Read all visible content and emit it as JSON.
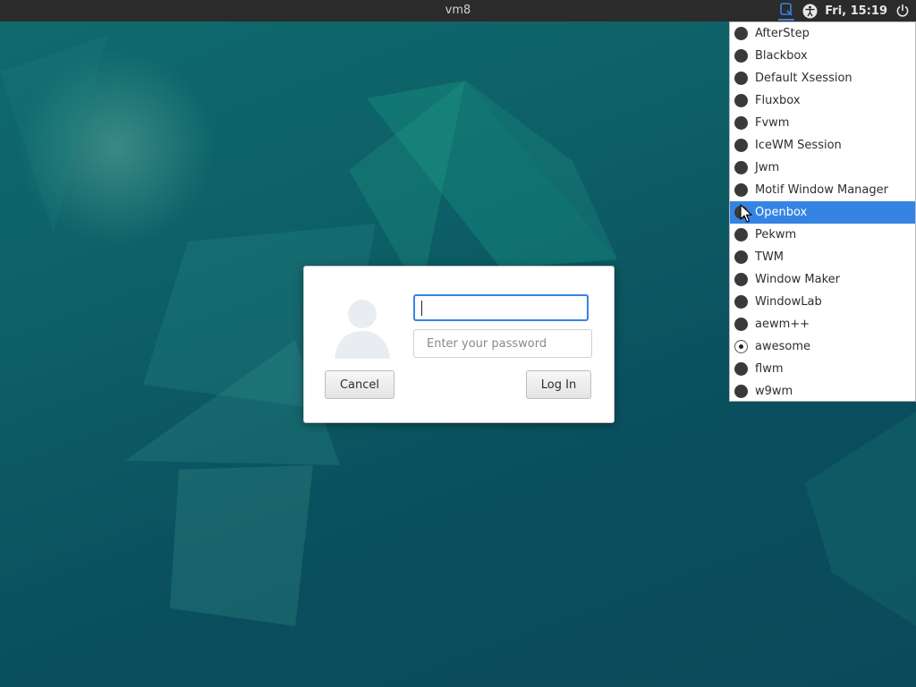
{
  "topbar": {
    "host": "vm8",
    "clock": "Fri, 15:19",
    "icons": [
      "session-selector-icon",
      "accessibility-icon",
      "power-icon"
    ]
  },
  "login": {
    "username_value": "",
    "password_placeholder": "Enter your password",
    "cancel_label": "Cancel",
    "login_label": "Log In"
  },
  "session_menu": {
    "highlighted": "Openbox",
    "selected": "awesome",
    "items": [
      "AfterStep",
      "Blackbox",
      "Default Xsession",
      "Fluxbox",
      "Fvwm",
      "IceWM Session",
      "Jwm",
      "Motif Window Manager",
      "Openbox",
      "Pekwm",
      "TWM",
      "Window Maker",
      "WindowLab",
      "aewm++",
      "awesome",
      "flwm",
      "w9wm"
    ]
  },
  "colors": {
    "accent": "#3584e4",
    "panel": "#2b2b2b",
    "wallpaper": "#0d5f66"
  }
}
